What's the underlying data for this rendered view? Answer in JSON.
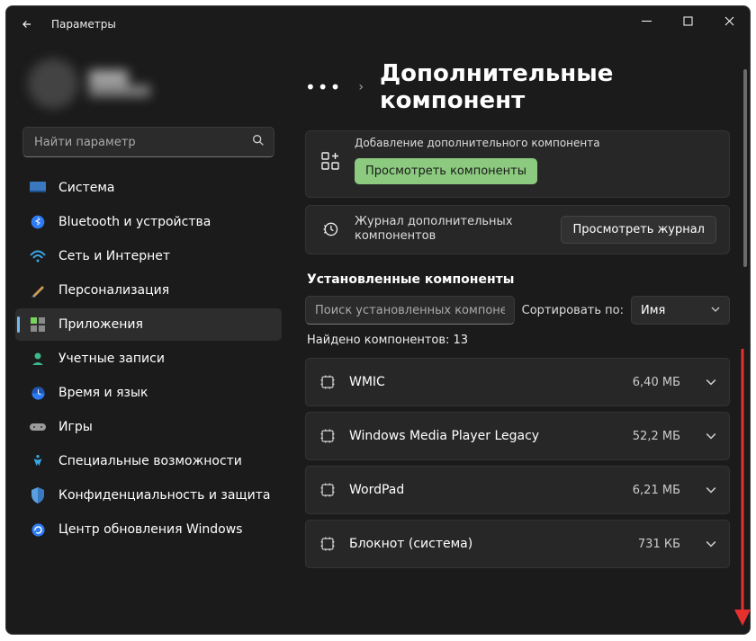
{
  "title": "Параметры",
  "search": {
    "placeholder": "Найти параметр"
  },
  "nav": [
    {
      "label": "Система",
      "icon": "system"
    },
    {
      "label": "Bluetooth и устройства",
      "icon": "bluetooth"
    },
    {
      "label": "Сеть и Интернет",
      "icon": "network"
    },
    {
      "label": "Персонализация",
      "icon": "personalize"
    },
    {
      "label": "Приложения",
      "icon": "apps",
      "active": true
    },
    {
      "label": "Учетные записи",
      "icon": "accounts"
    },
    {
      "label": "Время и язык",
      "icon": "time"
    },
    {
      "label": "Игры",
      "icon": "gaming"
    },
    {
      "label": "Специальные возможности",
      "icon": "accessibility"
    },
    {
      "label": "Конфиденциальность и защита",
      "icon": "privacy"
    },
    {
      "label": "Центр обновления Windows",
      "icon": "update"
    }
  ],
  "breadcrumb": {
    "page": "Дополнительные компонент"
  },
  "addCard": {
    "title": "Добавление дополнительного компонента",
    "button": "Просмотреть компоненты"
  },
  "historyCard": {
    "title": "Журнал дополнительных компонентов",
    "button": "Просмотреть журнал"
  },
  "section": "Установленные компоненты",
  "filter": {
    "placeholder": "Поиск установленных компонентов"
  },
  "sort": {
    "label": "Сортировать по:",
    "value": "Имя"
  },
  "found": "Найдено компонентов: 13",
  "items": [
    {
      "name": "WMIC",
      "size": "6,40 МБ"
    },
    {
      "name": "Windows Media Player Legacy",
      "size": "52,2 МБ"
    },
    {
      "name": "WordPad",
      "size": "6,21 МБ"
    },
    {
      "name": "Блокнот (система)",
      "size": "731 КБ"
    }
  ]
}
